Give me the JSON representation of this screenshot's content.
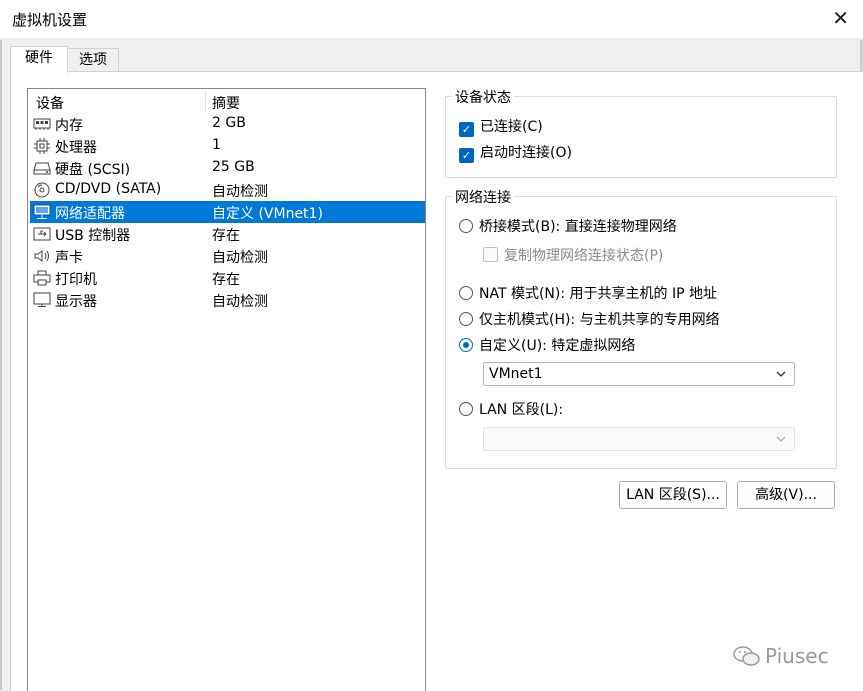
{
  "window": {
    "title": "虚拟机设置",
    "close_glyph": "✕"
  },
  "tabs": [
    {
      "label": "硬件",
      "active": true
    },
    {
      "label": "选项",
      "active": false
    }
  ],
  "device_list": {
    "columns": [
      "设备",
      "摘要"
    ],
    "rows": [
      {
        "icon": "memory-icon",
        "name": "内存",
        "summary": "2 GB",
        "selected": false
      },
      {
        "icon": "cpu-icon",
        "name": "处理器",
        "summary": "1",
        "selected": false
      },
      {
        "icon": "harddisk-icon",
        "name": "硬盘 (SCSI)",
        "summary": "25 GB",
        "selected": false
      },
      {
        "icon": "cd-dvd-icon",
        "name": "CD/DVD (SATA)",
        "summary": "自动检测",
        "selected": false
      },
      {
        "icon": "network-adapter-icon",
        "name": "网络适配器",
        "summary": "自定义 (VMnet1)",
        "selected": true
      },
      {
        "icon": "usb-icon",
        "name": "USB 控制器",
        "summary": "存在",
        "selected": false
      },
      {
        "icon": "speaker-icon",
        "name": "声卡",
        "summary": "自动检测",
        "selected": false
      },
      {
        "icon": "printer-icon",
        "name": "打印机",
        "summary": "存在",
        "selected": false
      },
      {
        "icon": "monitor-icon",
        "name": "显示器",
        "summary": "自动检测",
        "selected": false
      }
    ]
  },
  "device_status": {
    "title": "设备状态",
    "connected": {
      "label": "已连接(C)",
      "checked": true
    },
    "connect_at_power_on": {
      "label": "启动时连接(O)",
      "checked": true
    }
  },
  "network_connection": {
    "title": "网络连接",
    "bridged": {
      "label": "桥接模式(B): 直接连接物理网络",
      "selected": false
    },
    "replicate_state": {
      "label": "复制物理网络连接状态(P)",
      "checked": false
    },
    "nat": {
      "label": "NAT 模式(N): 用于共享主机的 IP 地址",
      "selected": false
    },
    "host_only": {
      "label": "仅主机模式(H): 与主机共享的专用网络",
      "selected": false
    },
    "custom": {
      "label": "自定义(U): 特定虚拟网络",
      "selected": true
    },
    "custom_select_value": "VMnet1",
    "lan_segment": {
      "label": "LAN 区段(L):",
      "selected": false
    },
    "lan_select_value": ""
  },
  "buttons": {
    "lan_segments": "LAN 区段(S)...",
    "advanced": "高级(V)..."
  },
  "watermark": "Piusec",
  "colors": {
    "selection": "#0078d7",
    "accent": "#0067c0"
  }
}
